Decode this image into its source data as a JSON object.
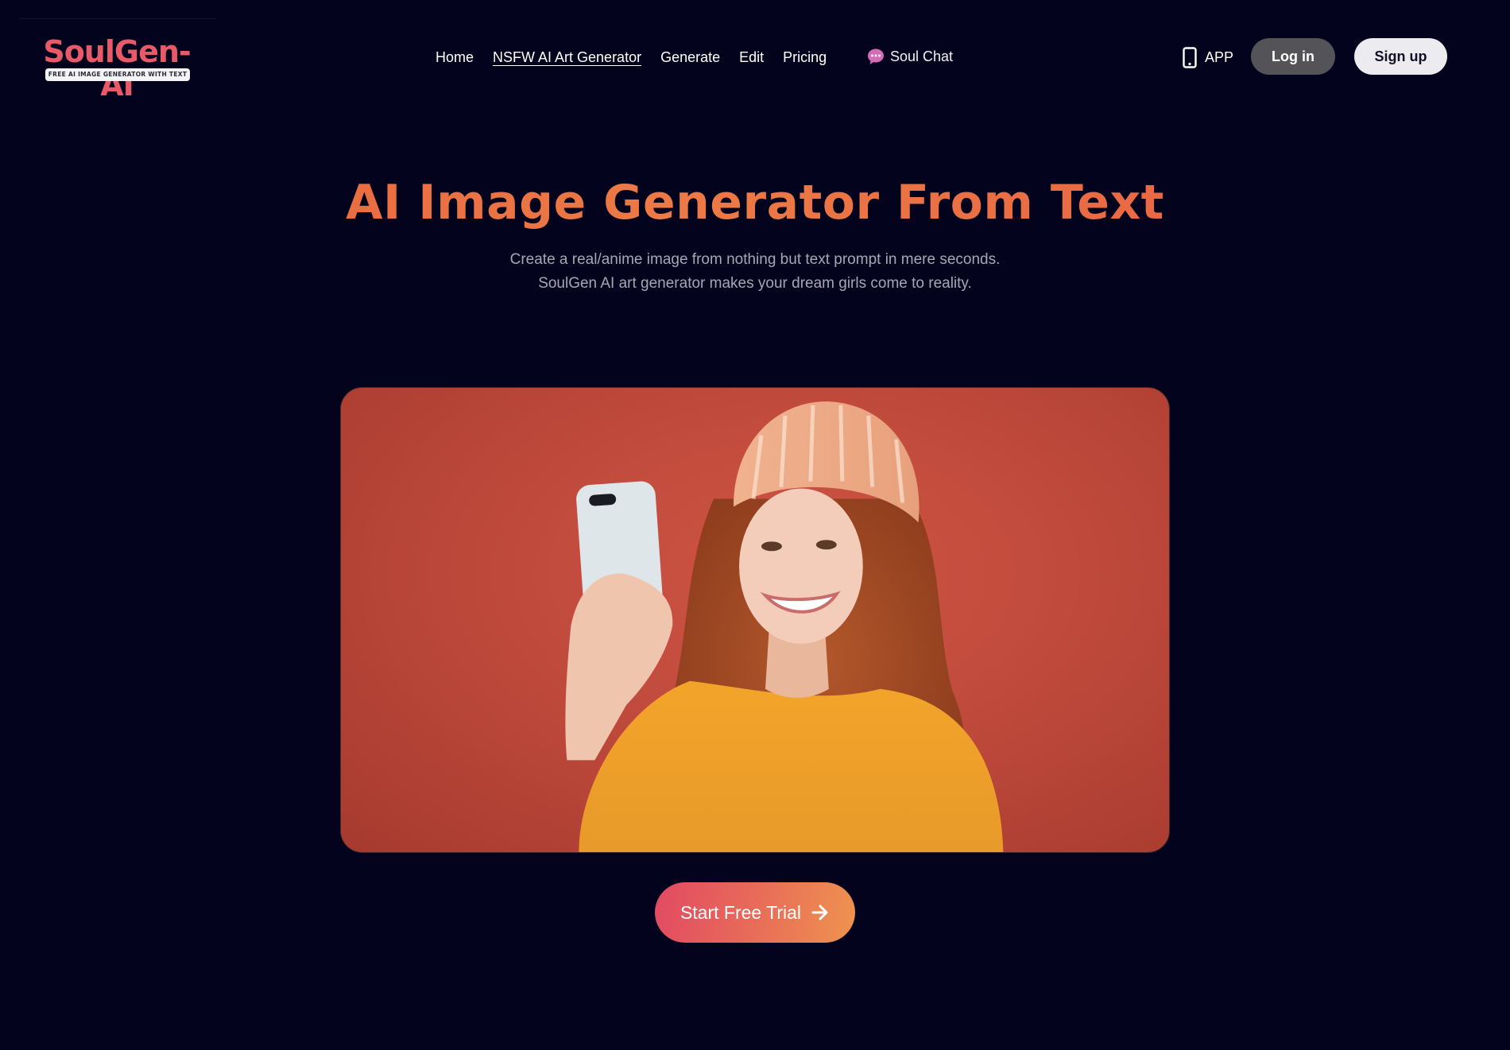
{
  "brand": {
    "name": "SoulGen-AI",
    "tagline": "FREE AI IMAGE GENERATOR WITH TEXT",
    "color": "#e85a68"
  },
  "nav": {
    "items": [
      {
        "label": "Home",
        "active": false
      },
      {
        "label": "NSFW AI Art Generator",
        "active": true
      },
      {
        "label": "Generate",
        "active": false
      },
      {
        "label": "Edit",
        "active": false
      },
      {
        "label": "Pricing",
        "active": false
      }
    ],
    "soul_chat": {
      "label": "Soul Chat",
      "icon": "chat-bubble-icon",
      "icon_color": "#d56bb7"
    }
  },
  "header_actions": {
    "app": {
      "label": "APP",
      "icon": "mobile-phone-icon"
    },
    "login": {
      "label": "Log in"
    },
    "signup": {
      "label": "Sign up"
    }
  },
  "hero": {
    "title": "AI Image Generator From Text",
    "subtitle_lines": [
      "Create a real/anime image from nothing but text prompt in mere seconds.",
      "SoulGen AI art generator makes your dream girls come to reality."
    ],
    "image_alt": "Smiling red-haired woman in a knit beanie and yellow sweater taking a selfie on a red background",
    "cta": {
      "label": "Start Free Trial",
      "icon": "arrow-right-icon"
    }
  },
  "colors": {
    "background": "#03031e",
    "title_gradient": [
      "#e6603e",
      "#ec7a46"
    ],
    "cta_gradient": [
      "#e24a63",
      "#ef934f"
    ]
  }
}
